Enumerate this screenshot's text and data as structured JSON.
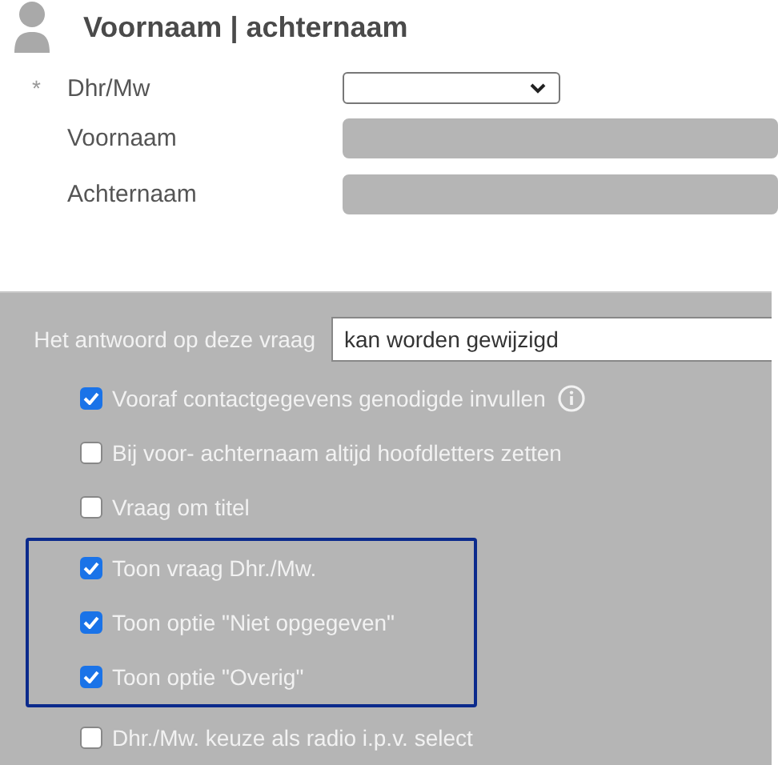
{
  "header": {
    "title": "Voornaam | achternaam"
  },
  "fields": [
    {
      "label": "Dhr/Mw",
      "required_mark": "*",
      "kind": "select",
      "disabled": false
    },
    {
      "label": "Voornaam",
      "kind": "text",
      "disabled": true
    },
    {
      "label": "Achternaam",
      "kind": "text",
      "disabled": true
    }
  ],
  "settings": {
    "answer_label": "Het antwoord op deze vraag",
    "answer_value": "kan worden gewijzigd",
    "options": [
      {
        "kind": "checkbox",
        "label": "Vooraf contactgegevens genodigde invullen",
        "checked": true,
        "info": true
      },
      {
        "kind": "checkbox",
        "label": "Bij voor- achternaam altijd hoofdletters zetten",
        "checked": false
      },
      {
        "kind": "checkbox",
        "label": "Vraag om titel",
        "checked": false
      },
      {
        "kind": "group",
        "items": [
          {
            "label": "Toon vraag Dhr./Mw.",
            "checked": true
          },
          {
            "label": "Toon optie \"Niet opgegeven\"",
            "checked": true
          },
          {
            "label": "Toon optie \"Overig\"",
            "checked": true
          }
        ]
      },
      {
        "kind": "checkbox",
        "label": "Dhr./Mw. keuze als radio i.p.v. select",
        "checked": false
      }
    ]
  }
}
